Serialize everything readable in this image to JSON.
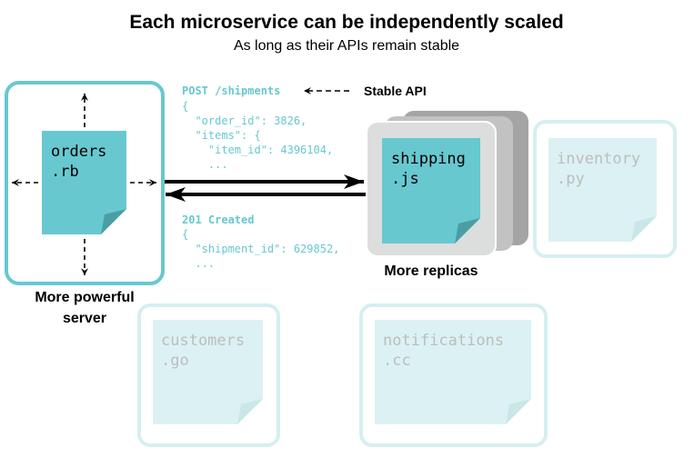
{
  "title": "Each microservice can be independently scaled",
  "subtitle": "As long as their APIs remain stable",
  "colors": {
    "accent": "#67c8d0",
    "accent_dark": "#4a9ea3",
    "faded_border": "#d5eff1",
    "faded_fill": "#dcf1f3",
    "faded_text": "#bdbdbd",
    "replica_front": "#dcdedd",
    "replica_mid": "#c2c2c2",
    "replica_back": "#a4a4a4"
  },
  "services": {
    "orders": {
      "line1": "orders",
      "line2": ".rb",
      "caption_line1": "More powerful",
      "caption_line2": "server"
    },
    "shipping": {
      "line1": "shipping",
      "line2": ".js",
      "caption": "More replicas"
    },
    "inventory": {
      "line1": "inventory",
      "line2": ".py"
    },
    "customers": {
      "line1": "customers",
      "line2": ".go"
    },
    "notifications": {
      "line1": "notifications",
      "line2": ".cc"
    }
  },
  "request": {
    "method_line": "POST /shipments",
    "body": [
      "{",
      "  \"order_id\": 3826,",
      "  \"items\": {",
      "    \"item_id\": 4396104,",
      "    ..."
    ]
  },
  "response": {
    "status_line": "201 Created",
    "body": [
      "{",
      "  \"shipment_id\": 629852,",
      "  ..."
    ]
  },
  "stable_api_label": "Stable API"
}
